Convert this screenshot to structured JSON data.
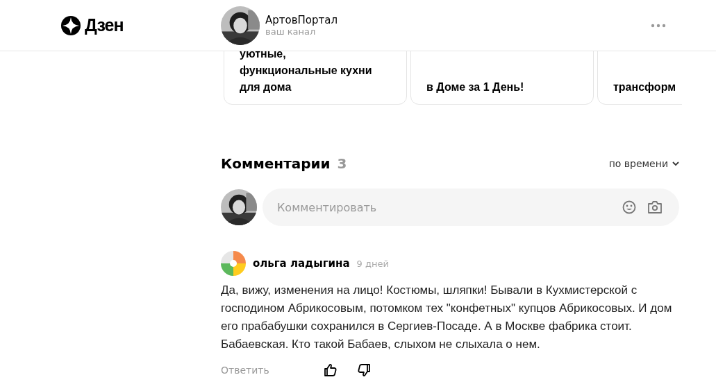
{
  "header": {
    "logo": "Дзен",
    "channel": {
      "name": "АртовПортал",
      "subtitle": "ваш канал"
    }
  },
  "cards": [
    {
      "lines": [
        "уютные,",
        "функциональные кухни",
        "для дома"
      ]
    },
    {
      "lines": [
        "в Доме за 1 День!"
      ]
    },
    {
      "lines": [
        "трансформ"
      ]
    }
  ],
  "comments": {
    "title": "Комментарии",
    "count": "3",
    "sort": "по времени",
    "input": {
      "placeholder": "Комментировать"
    },
    "items": [
      {
        "author": "ольга ладыгина",
        "time": "9 дней",
        "text": "Да, вижу, изменения на лицо! Костюмы, шляпки! Бывали в Кухмистерской с господином Абрикосовым, потомком тех \"конфетных\" купцов Абрикосовых. И дом его прабабушки сохранился в Сергиев-Посаде. А в Москве фабрика стоит. Бабаевская. Кто такой Бабаев, слыхом не слыхала о нем.",
        "reply": "Ответить"
      }
    ]
  }
}
